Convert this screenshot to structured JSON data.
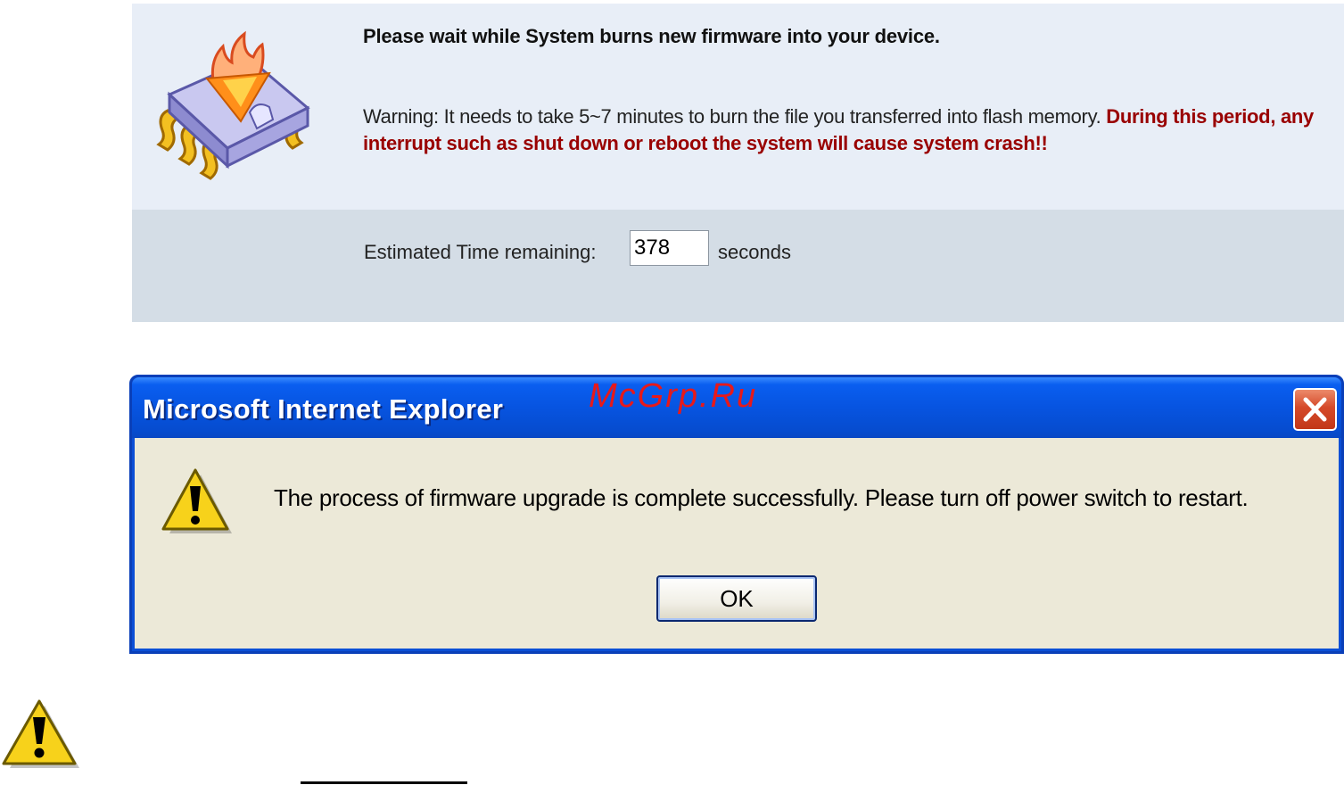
{
  "firmware_panel": {
    "title": "Please wait while System burns new firmware into your device.",
    "warning_text": "Warning: It needs to take 5~7 minutes to burn the file you transferred into flash memory.",
    "warning_danger_text": "During this period, any interrupt such as shut down or reboot the system will cause system crash!!",
    "estimated_label": "Estimated Time remaining:",
    "estimated_value": "378",
    "estimated_unit": "seconds",
    "icon": "burning-chip-icon"
  },
  "dialog": {
    "title": "Microsoft Internet Explorer",
    "watermark": "McGrp.Ru",
    "message": "The process of firmware upgrade is complete successfully. Please turn off power switch to restart.",
    "ok_label": "OK",
    "icon": "warning-icon",
    "close_icon": "close-icon",
    "colors": {
      "titlebar": "#0754e0",
      "client": "#ece9d8",
      "close": "#d54a2a",
      "watermark": "#e8191a"
    }
  },
  "page": {
    "icon": "warning-icon"
  }
}
